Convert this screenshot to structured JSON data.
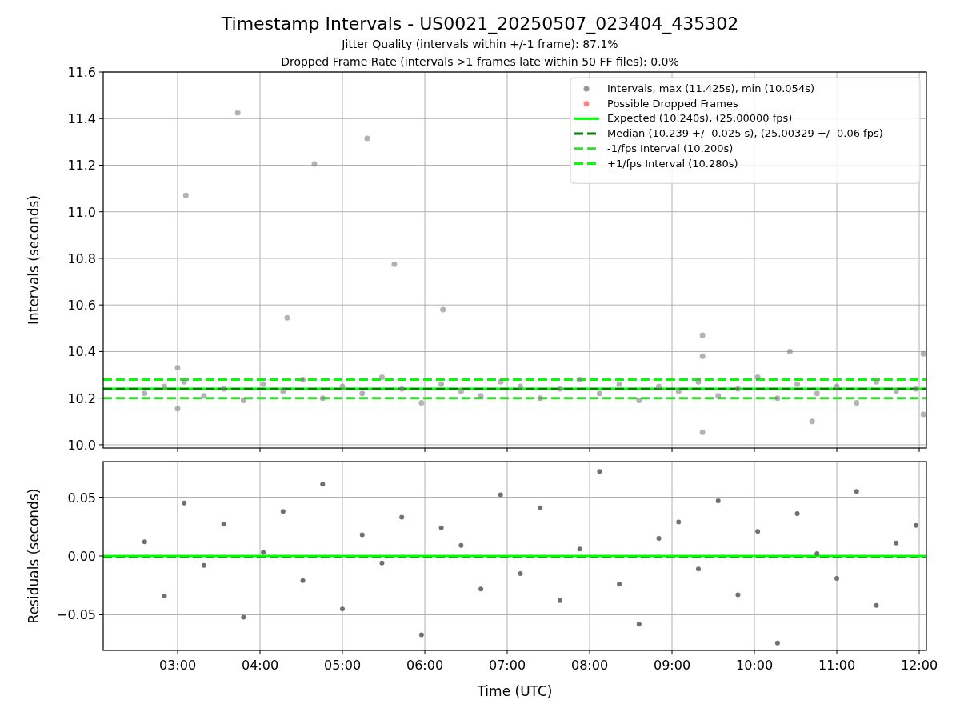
{
  "figure": {
    "title": "Timestamp Intervals - US0021_20250507_023404_435302",
    "subtitle_lines": [
      "Jitter Quality (intervals within +/-1 frame): 87.1%",
      "Dropped Frame Rate (intervals >1 frames late within 50 FF files): 0.0%"
    ]
  },
  "top_panel": {
    "chart_data": {
      "type": "scatter",
      "ylabel": "Intervals (seconds)",
      "xlim": [
        2.097,
        12.087
      ],
      "ylim": [
        9.986,
        11.6
      ],
      "yticks": [
        {
          "value": 10,
          "label": "10.0"
        },
        {
          "value": 10.2,
          "label": "10.2"
        },
        {
          "value": 10.4,
          "label": "10.4"
        },
        {
          "value": 10.6,
          "label": "10.6"
        },
        {
          "value": 10.8,
          "label": "10.8"
        },
        {
          "value": 11,
          "label": "11.0"
        },
        {
          "value": 11.2,
          "label": "11.2"
        },
        {
          "value": 11.4,
          "label": "11.4"
        },
        {
          "value": 11.6,
          "label": "11.6"
        }
      ],
      "series": [
        {
          "name": "Intervals, max (11.425s), min (10.054s)",
          "color": "#808080",
          "x": [
            2.6,
            2.84,
            3.08,
            3.32,
            3.56,
            3.8,
            4.04,
            4.28,
            4.52,
            4.76,
            5.0,
            5.24,
            5.48,
            5.72,
            5.96,
            6.2,
            6.44,
            6.68,
            6.92,
            7.16,
            7.4,
            7.64,
            7.88,
            8.12,
            8.36,
            8.6,
            8.84,
            9.08,
            9.32,
            9.56,
            9.8,
            10.04,
            10.28,
            10.52,
            10.76,
            11.0,
            11.24,
            11.48,
            11.72,
            11.96,
            3.1,
            3.73,
            4.33,
            4.66,
            5.3,
            5.63,
            6.22,
            9.37,
            9.37,
            9.37,
            10.43,
            10.7,
            12.05,
            12.05,
            3.0,
            3.0
          ],
          "values": [
            10.22,
            10.25,
            10.27,
            10.21,
            10.24,
            10.19,
            10.26,
            10.23,
            10.28,
            10.2,
            10.25,
            10.22,
            10.29,
            10.24,
            10.18,
            10.26,
            10.23,
            10.21,
            10.27,
            10.25,
            10.2,
            10.24,
            10.28,
            10.22,
            10.26,
            10.19,
            10.25,
            10.23,
            10.27,
            10.21,
            10.24,
            10.29,
            10.2,
            10.26,
            10.22,
            10.25,
            10.18,
            10.27,
            10.23,
            10.24,
            11.07,
            11.425,
            10.545,
            11.205,
            11.315,
            10.775,
            10.58,
            10.47,
            10.38,
            10.054,
            10.4,
            10.1,
            10.39,
            10.13,
            10.33,
            10.155
          ]
        },
        {
          "name": "Possible Dropped Frames",
          "color": "#ff6666"
        },
        {
          "name": "Expected (10.240s), (25.00000 fps)",
          "color": "#00ff00",
          "type": "line",
          "line_style": "solid",
          "x": [
            2.097,
            12.087
          ],
          "values": [
            10.24,
            10.24
          ]
        },
        {
          "name": "Median (10.239 +/- 0.025 s), (25.00329 +/- 0.06 fps)",
          "color": "#007f00",
          "type": "line",
          "line_style": "dashed",
          "x": [
            2.097,
            12.087
          ],
          "values": [
            10.239,
            10.239
          ]
        },
        {
          "name": "-1/fps Interval (10.200s)",
          "color": "#33dd33",
          "type": "line",
          "line_style": "dashed",
          "x": [
            2.097,
            12.087
          ],
          "values": [
            10.2,
            10.2
          ]
        },
        {
          "name": "+1/fps Interval (10.280s)",
          "color": "#00ff00",
          "type": "line",
          "line_style": "dashed",
          "x": [
            2.097,
            12.087
          ],
          "values": [
            10.28,
            10.28
          ]
        }
      ],
      "grid": true,
      "legend": "upper right"
    }
  },
  "bottom_panel": {
    "chart_data": {
      "type": "scatter",
      "xlabel": "Time (UTC)",
      "ylabel": "Residuals (seconds)",
      "xlim": [
        2.097,
        12.087
      ],
      "ylim": [
        -0.0803,
        0.0803
      ],
      "xticks": [
        {
          "value": 3,
          "label": "03:00"
        },
        {
          "value": 4,
          "label": "04:00"
        },
        {
          "value": 5,
          "label": "05:00"
        },
        {
          "value": 6,
          "label": "06:00"
        },
        {
          "value": 7,
          "label": "07:00"
        },
        {
          "value": 8,
          "label": "08:00"
        },
        {
          "value": 9,
          "label": "09:00"
        },
        {
          "value": 10,
          "label": "10:00"
        },
        {
          "value": 11,
          "label": "11:00"
        },
        {
          "value": 12,
          "label": "12:00"
        }
      ],
      "yticks": [
        {
          "value": -0.05,
          "label": "−0.05"
        },
        {
          "value": 0,
          "label": "0.00"
        },
        {
          "value": 0.05,
          "label": "0.05"
        }
      ],
      "series": [
        {
          "color": "#707070",
          "x": [
            2.6,
            2.84,
            3.08,
            3.32,
            3.56,
            3.8,
            4.04,
            4.28,
            4.52,
            4.76,
            5.0,
            5.24,
            5.48,
            5.72,
            5.96,
            6.2,
            6.44,
            6.68,
            6.92,
            7.16,
            7.4,
            7.64,
            7.88,
            8.12,
            8.36,
            8.6,
            8.84,
            9.08,
            9.32,
            9.56,
            9.8,
            10.04,
            10.28,
            10.52,
            10.76,
            11.0,
            11.24,
            11.48,
            11.72,
            11.96
          ],
          "values": [
            0.012,
            -0.034,
            0.045,
            -0.008,
            0.027,
            -0.052,
            0.003,
            0.038,
            -0.021,
            0.061,
            -0.045,
            0.018,
            -0.006,
            0.033,
            -0.067,
            0.024,
            0.009,
            -0.028,
            0.052,
            -0.015,
            0.041,
            -0.038,
            0.006,
            0.072,
            -0.024,
            -0.058,
            0.015,
            0.029,
            -0.011,
            0.047,
            -0.033,
            0.021,
            -0.074,
            0.036,
            0.002,
            -0.019,
            0.055,
            -0.042,
            0.011,
            0.026
          ]
        },
        {
          "color": "#007f00",
          "type": "line",
          "line_style": "dashed",
          "x": [
            2.097,
            12.087
          ],
          "values": [
            -0.001,
            -0.001
          ]
        },
        {
          "color": "#00ff00",
          "type": "line",
          "line_style": "solid",
          "x": [
            2.097,
            12.087
          ],
          "values": [
            0,
            0
          ]
        }
      ],
      "grid": true
    }
  }
}
